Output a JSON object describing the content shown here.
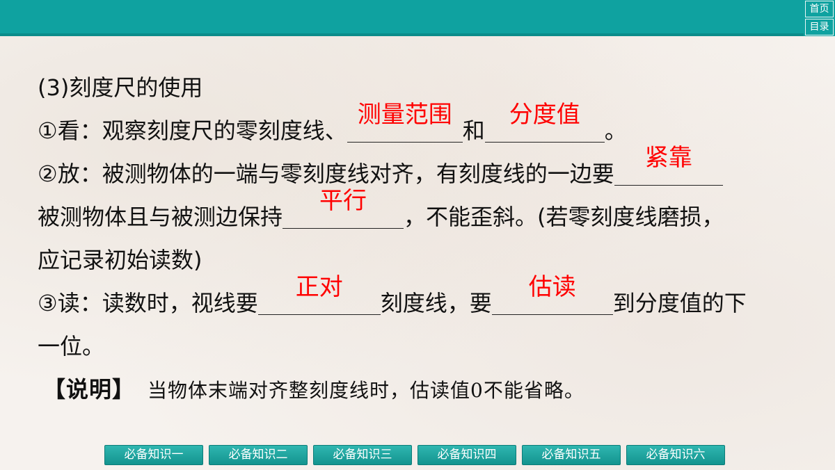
{
  "corner_nav": {
    "home_label": "首页",
    "toc_label": "目录"
  },
  "content": {
    "heading": "(3)刻度尺的使用",
    "look": {
      "prefix": "①看：观察刻度尺的零刻度线、",
      "answer1": "测量范围",
      "mid": "和",
      "answer2": "分度值",
      "suffix": "。"
    },
    "place": {
      "prefix": "②放：被测物体的一端与零刻度线对齐，有刻度线的一边要",
      "answer1": "紧靠",
      "line2_prefix": "被测物体且与被测边保持",
      "answer2": "平行",
      "line2_suffix": "，不能歪斜。(若零刻度线磨损，",
      "line3": "应记录初始读数)"
    },
    "read": {
      "prefix": "③读：读数时，视线要",
      "answer1": "正对",
      "mid": "刻度线，要",
      "answer2": "估读",
      "suffix": "到分度值的下",
      "line2": "一位。"
    },
    "note": {
      "label": "【说明】",
      "text": "当物体末端对齐整刻度线时，估读值0不能省略。"
    }
  },
  "bottom_nav": [
    "必备知识一",
    "必备知识二",
    "必备知识三",
    "必备知识四",
    "必备知识五",
    "必备知识六"
  ],
  "colors": {
    "accent": "#0fa2a0",
    "answer": "#ff0000"
  }
}
